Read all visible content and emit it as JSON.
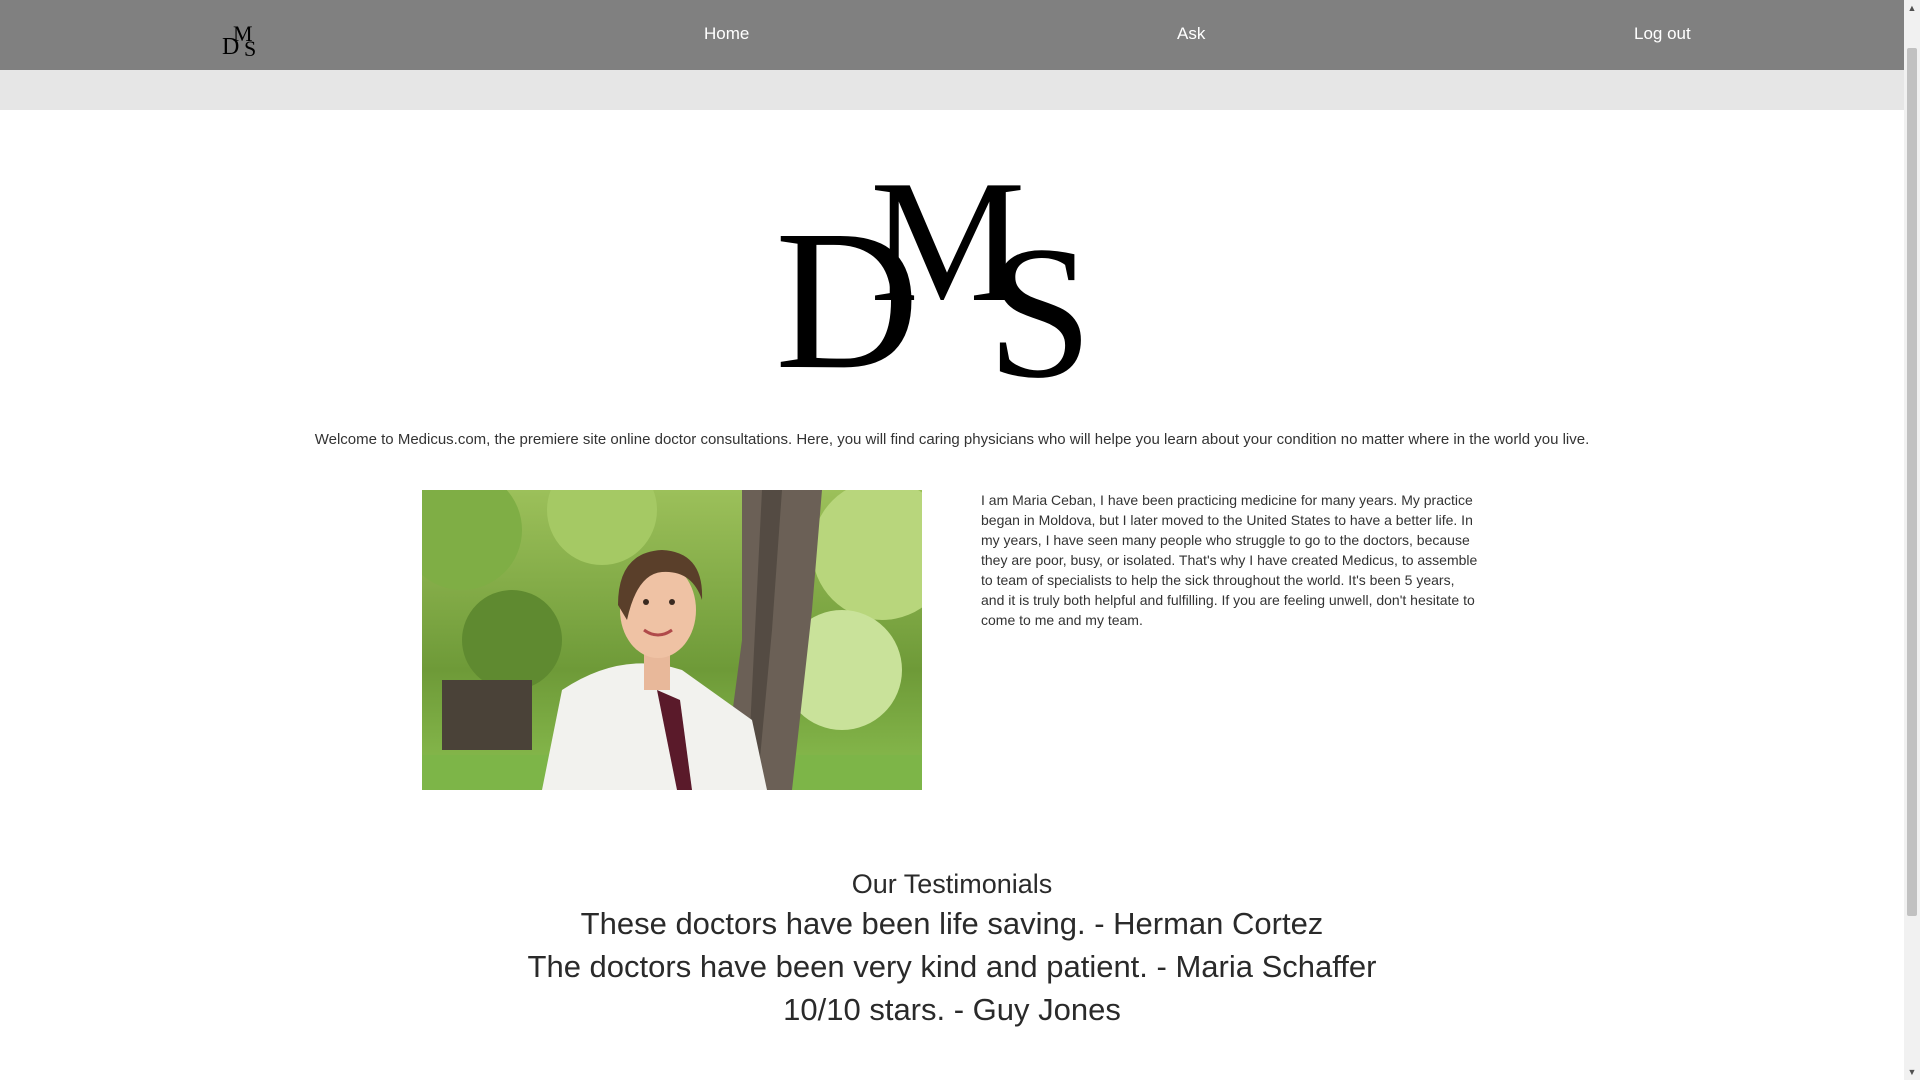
{
  "nav": {
    "logo_text": "DMS",
    "links": [
      {
        "label": "Home"
      },
      {
        "label": "Ask"
      },
      {
        "label": "Log out"
      }
    ]
  },
  "hero": {
    "logo_text": "DMS"
  },
  "welcome_text": "Welcome to Medicus.com, the premiere site online doctor consultations. Here, you will find caring physicians who will helpe you learn about your condition no matter where in the world you live.",
  "about": {
    "photo_alt": "Maria Ceban",
    "bio": "I am Maria Ceban, I have been practicing medicine for many years. My practice began in Moldova, but I later moved to the United States to have a better life. In my years, I have seen many people who struggle to go to the doctors, because they are poor, busy, or isolated. That's why I have created Medicus, to assemble to team of specialists to help the sick throughout the world. It's been 5 years, and it is truly both helpful and fulfilling. If you are feeling unwell, don't hesitate to come to me and my team."
  },
  "testimonials": {
    "heading": "Our Testimonials",
    "items": [
      "These doctors have been life saving. - Herman Cortez",
      "The doctors have been very kind and patient. - Maria Schaffer",
      "10/10 stars. - Guy Jones"
    ]
  },
  "colors": {
    "navbar": "#808080",
    "subbar": "#e6e6e6",
    "nav_text": "#ffffff"
  }
}
